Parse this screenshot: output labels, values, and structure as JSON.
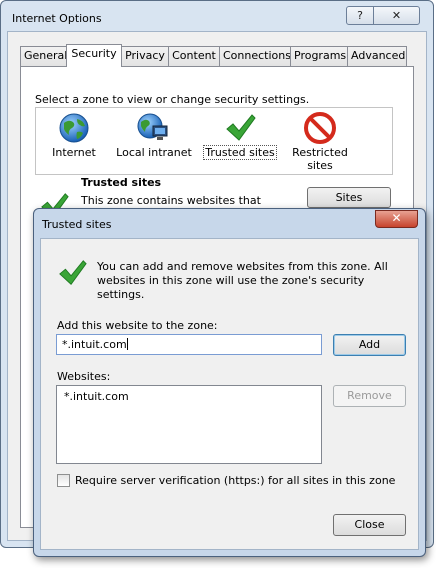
{
  "outer_window": {
    "title": "Internet Options",
    "help_glyph": "?",
    "close_glyph": "✕",
    "tabs": [
      {
        "label": "General"
      },
      {
        "label": "Security",
        "active": true
      },
      {
        "label": "Privacy"
      },
      {
        "label": "Content"
      },
      {
        "label": "Connections"
      },
      {
        "label": "Programs"
      },
      {
        "label": "Advanced"
      }
    ],
    "security": {
      "zone_prompt": "Select a zone to view or change security settings.",
      "zones": [
        {
          "label": "Internet",
          "icon": "globe-icon"
        },
        {
          "label": "Local intranet",
          "icon": "intranet-globe-icon"
        },
        {
          "label": "Trusted sites",
          "icon": "green-check-icon",
          "selected": true
        },
        {
          "label": "Restricted sites",
          "icon": "restricted-circle-icon"
        }
      ],
      "zone_heading": "Trusted sites",
      "zone_description": "This zone contains websites that you trust not to damage your computer or",
      "sites_button": "Sites"
    }
  },
  "trusted_dialog": {
    "title": "Trusted sites",
    "close_glyph": "✕",
    "info_text": "You can add and remove websites from this zone. All websites in this zone will use the zone's security settings.",
    "add_label": "Add this website to the zone:",
    "add_input_value": "*.intuit.com",
    "add_button": "Add",
    "websites_label": "Websites:",
    "websites": [
      "*.intuit.com"
    ],
    "remove_button": "Remove",
    "verify_label": "Require server verification (https:) for all sites in this zone",
    "verify_checked": false,
    "close_button": "Close"
  },
  "colors": {
    "frame_blue": "#c7d7ea",
    "check_green": "#3aa537",
    "restricted_red": "#d42a1c",
    "close_red": "#c7432d"
  }
}
